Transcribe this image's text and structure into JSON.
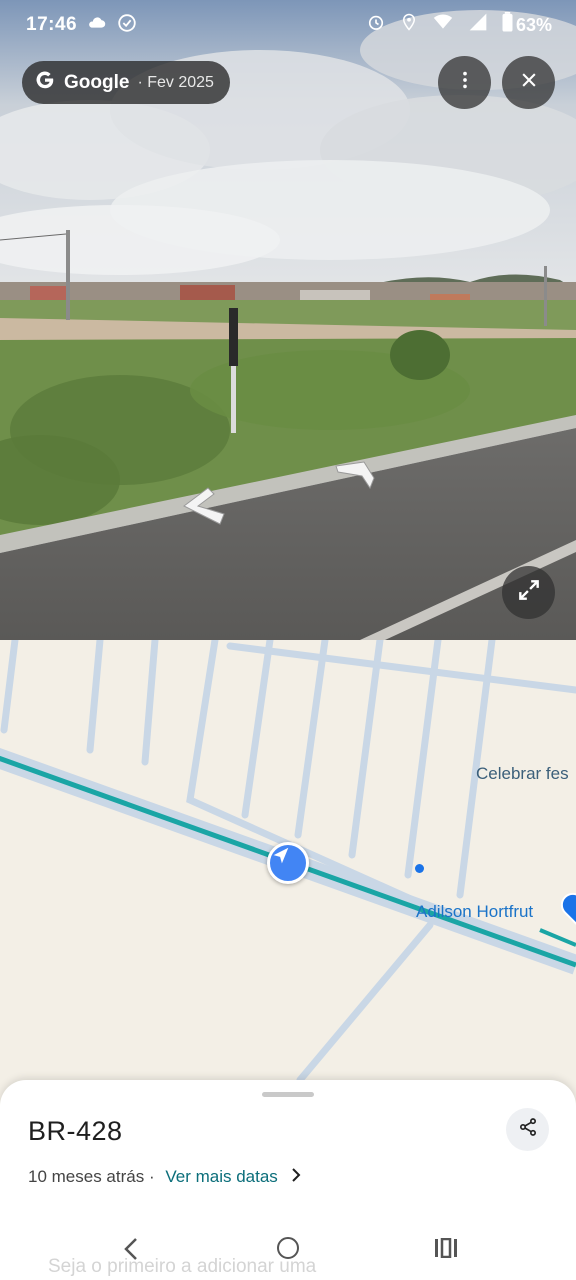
{
  "status_bar": {
    "time": "17:46",
    "battery": "63%",
    "icons": [
      "cloud-icon",
      "check-circle-icon",
      "alarm-icon",
      "location-icon",
      "wifi-icon",
      "signal-icon",
      "battery-icon"
    ]
  },
  "streetview": {
    "brand": "Google",
    "capture_date": "· Fev 2025",
    "icons": [
      "google-g-icon",
      "more-vert-icon",
      "close-icon",
      "expand-icon",
      "nav-arrow-left-icon",
      "nav-arrow-right-icon"
    ]
  },
  "map": {
    "labels": {
      "celebrar": "Celebrar fes",
      "adilson": "Adilson Hortfrut"
    },
    "colors": {
      "land": "#f3efe6",
      "roads": "#c9d7e6",
      "highlight_route": "#1aa5a5",
      "marker": "#4285f4"
    }
  },
  "sheet": {
    "title": "BR-428",
    "age": "10 meses atrás",
    "separator": " · ",
    "more_dates": "Ver mais datas",
    "faded_prompt": "Seja o primeiro a adicionar uma"
  },
  "navbar": {
    "icons": [
      "back-icon",
      "home-icon",
      "recents-icon"
    ]
  }
}
